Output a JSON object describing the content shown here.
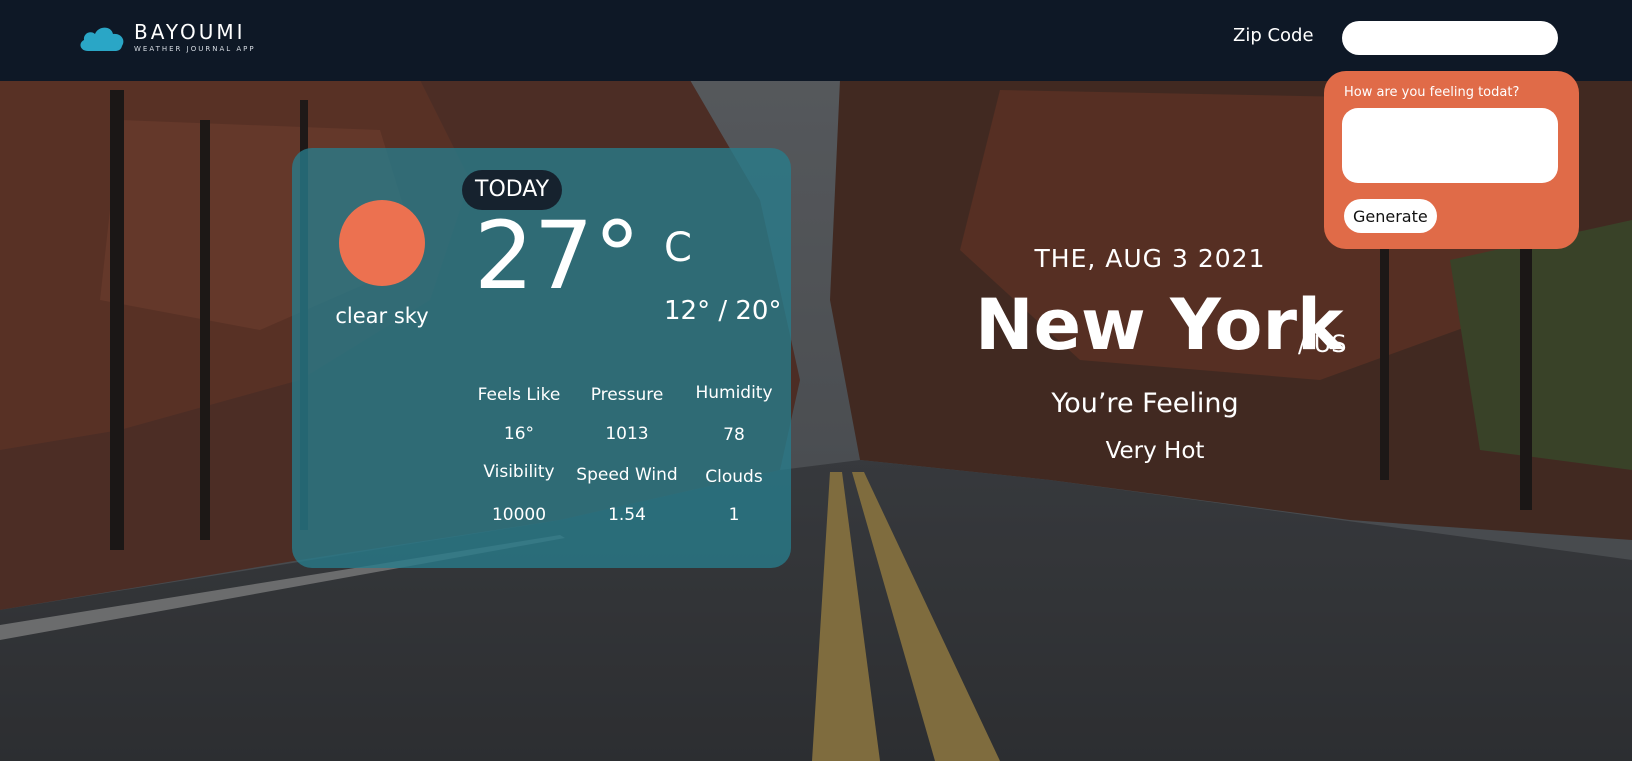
{
  "header": {
    "brand_title": "BAYOUMI",
    "brand_subtitle": "WEATHER JOURNAL APP",
    "zip_label": "Zip Code",
    "zip_value": ""
  },
  "feelings": {
    "label": "How are you feeling todat?",
    "value": "",
    "generate_label": "Generate"
  },
  "weather": {
    "today_label": "TODAY",
    "description": "clear sky",
    "temperature": "27°",
    "unit": "C",
    "range": "12° / 20°",
    "stats": [
      {
        "label": "Feels Like",
        "value": "16°"
      },
      {
        "label": "Pressure",
        "value": "1013"
      },
      {
        "label": "Humidity",
        "value": "78"
      },
      {
        "label": "Visibility",
        "value": "10000"
      },
      {
        "label": "Speed Wind",
        "value": "1.54"
      },
      {
        "label": "Clouds",
        "value": "1"
      }
    ]
  },
  "location": {
    "date": "THE, AUG 3 2021",
    "city": "New York",
    "country": "/ US",
    "feeling_title": "You’re Feeling",
    "feeling_value": "Very Hot"
  },
  "colors": {
    "header_bg": "#0e1826",
    "accent_orange": "#e06b48",
    "sun": "#ec7150",
    "card_bg": "#287c8c",
    "logo_cloud": "#2aa6c6"
  },
  "icons": {
    "logo": "cloud-icon",
    "weather": "sun-icon"
  }
}
